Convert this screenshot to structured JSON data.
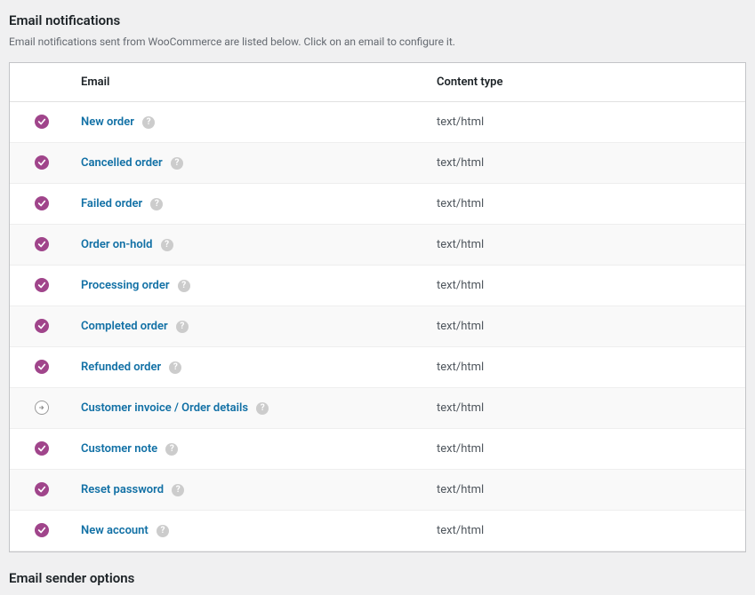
{
  "section": {
    "title": "Email notifications",
    "description": "Email notifications sent from WooCommerce are listed below. Click on an email to configure it."
  },
  "table": {
    "headers": {
      "status": "",
      "email": "Email",
      "content_type": "Content type"
    }
  },
  "emails": [
    {
      "status": "enabled",
      "name": "New order",
      "content_type": "text/html"
    },
    {
      "status": "enabled",
      "name": "Cancelled order",
      "content_type": "text/html"
    },
    {
      "status": "enabled",
      "name": "Failed order",
      "content_type": "text/html"
    },
    {
      "status": "enabled",
      "name": "Order on-hold",
      "content_type": "text/html"
    },
    {
      "status": "enabled",
      "name": "Processing order",
      "content_type": "text/html"
    },
    {
      "status": "enabled",
      "name": "Completed order",
      "content_type": "text/html"
    },
    {
      "status": "enabled",
      "name": "Refunded order",
      "content_type": "text/html"
    },
    {
      "status": "manual",
      "name": "Customer invoice / Order details",
      "content_type": "text/html"
    },
    {
      "status": "enabled",
      "name": "Customer note",
      "content_type": "text/html"
    },
    {
      "status": "enabled",
      "name": "Reset password",
      "content_type": "text/html"
    },
    {
      "status": "enabled",
      "name": "New account",
      "content_type": "text/html"
    }
  ],
  "bottom_section": {
    "title": "Email sender options"
  },
  "help_glyph": "?"
}
